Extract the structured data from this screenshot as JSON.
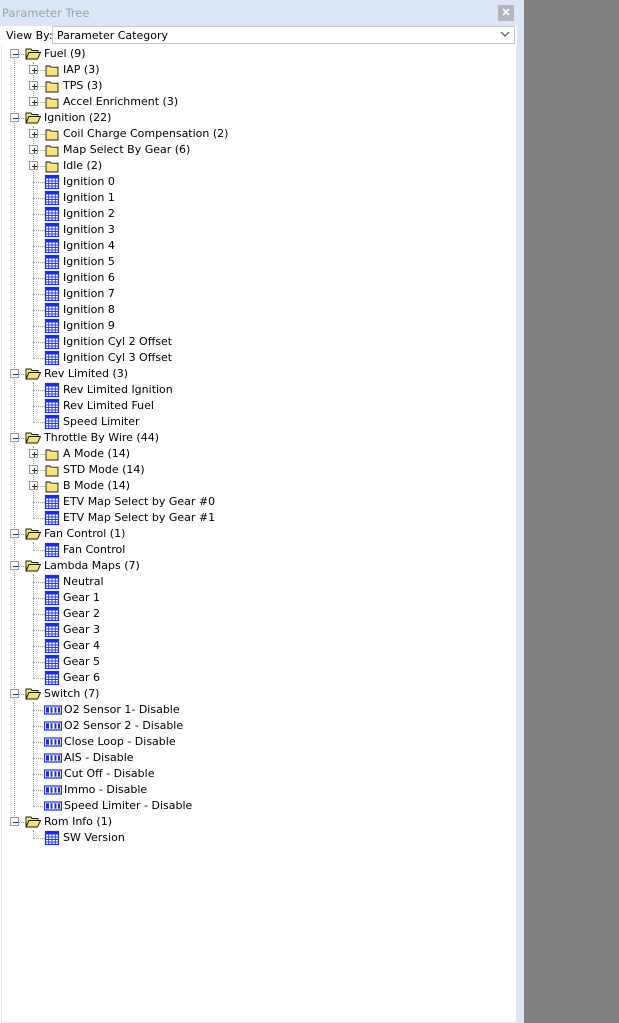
{
  "panel": {
    "title": "Parameter Tree",
    "close_glyph": "×",
    "view_by_label": "View By:",
    "view_by_value": "Parameter Category"
  },
  "colors": {
    "background_gray": "#808080",
    "titlebar": "#dde7f3",
    "folder_fill": "#f9e27e",
    "table_icon": "#1c2dd8",
    "switch_icon": "#1c2dd8"
  },
  "tree": [
    {
      "label": "Fuel (9)",
      "level": 0,
      "type": "folder-open",
      "expander": "minus"
    },
    {
      "label": "IAP (3)",
      "level": 1,
      "type": "folder",
      "expander": "plus"
    },
    {
      "label": "TPS (3)",
      "level": 1,
      "type": "folder",
      "expander": "plus"
    },
    {
      "label": "Accel Enrichment (3)",
      "level": 1,
      "type": "folder",
      "expander": "plus"
    },
    {
      "label": "Ignition (22)",
      "level": 0,
      "type": "folder-open",
      "expander": "minus"
    },
    {
      "label": "Coil Charge Compensation (2)",
      "level": 1,
      "type": "folder",
      "expander": "plus"
    },
    {
      "label": "Map Select By Gear (6)",
      "level": 1,
      "type": "folder",
      "expander": "plus"
    },
    {
      "label": "Idle (2)",
      "level": 1,
      "type": "folder",
      "expander": "plus"
    },
    {
      "label": "Ignition 0",
      "level": 1,
      "type": "table"
    },
    {
      "label": "Ignition 1",
      "level": 1,
      "type": "table"
    },
    {
      "label": "Ignition 2",
      "level": 1,
      "type": "table"
    },
    {
      "label": "Ignition 3",
      "level": 1,
      "type": "table"
    },
    {
      "label": "Ignition 4",
      "level": 1,
      "type": "table"
    },
    {
      "label": "Ignition 5",
      "level": 1,
      "type": "table"
    },
    {
      "label": "Ignition 6",
      "level": 1,
      "type": "table"
    },
    {
      "label": "Ignition 7",
      "level": 1,
      "type": "table"
    },
    {
      "label": "Ignition 8",
      "level": 1,
      "type": "table"
    },
    {
      "label": "Ignition 9",
      "level": 1,
      "type": "table"
    },
    {
      "label": "Ignition Cyl 2 Offset",
      "level": 1,
      "type": "table"
    },
    {
      "label": "Ignition Cyl 3 Offset",
      "level": 1,
      "type": "table"
    },
    {
      "label": "Rev Limited (3)",
      "level": 0,
      "type": "folder-open",
      "expander": "minus"
    },
    {
      "label": "Rev Limited Ignition",
      "level": 1,
      "type": "table"
    },
    {
      "label": "Rev Limited Fuel",
      "level": 1,
      "type": "table"
    },
    {
      "label": "Speed Limiter",
      "level": 1,
      "type": "table"
    },
    {
      "label": "Throttle By Wire (44)",
      "level": 0,
      "type": "folder-open",
      "expander": "minus"
    },
    {
      "label": "A Mode (14)",
      "level": 1,
      "type": "folder",
      "expander": "plus"
    },
    {
      "label": "STD Mode (14)",
      "level": 1,
      "type": "folder",
      "expander": "plus"
    },
    {
      "label": "B Mode (14)",
      "level": 1,
      "type": "folder",
      "expander": "plus"
    },
    {
      "label": "ETV Map Select by Gear #0",
      "level": 1,
      "type": "table"
    },
    {
      "label": "ETV Map Select by Gear #1",
      "level": 1,
      "type": "table"
    },
    {
      "label": "Fan Control (1)",
      "level": 0,
      "type": "folder-open",
      "expander": "minus"
    },
    {
      "label": "Fan Control",
      "level": 1,
      "type": "table"
    },
    {
      "label": "Lambda Maps (7)",
      "level": 0,
      "type": "folder-open",
      "expander": "minus"
    },
    {
      "label": "Neutral",
      "level": 1,
      "type": "table"
    },
    {
      "label": "Gear 1",
      "level": 1,
      "type": "table"
    },
    {
      "label": "Gear 2",
      "level": 1,
      "type": "table"
    },
    {
      "label": "Gear 3",
      "level": 1,
      "type": "table"
    },
    {
      "label": "Gear 4",
      "level": 1,
      "type": "table"
    },
    {
      "label": "Gear 5",
      "level": 1,
      "type": "table"
    },
    {
      "label": "Gear 6",
      "level": 1,
      "type": "table"
    },
    {
      "label": "Switch (7)",
      "level": 0,
      "type": "folder-open",
      "expander": "minus"
    },
    {
      "label": "O2 Sensor 1- Disable",
      "level": 1,
      "type": "switch"
    },
    {
      "label": "O2 Sensor 2 - Disable",
      "level": 1,
      "type": "switch"
    },
    {
      "label": "Close Loop - Disable",
      "level": 1,
      "type": "switch"
    },
    {
      "label": "AIS - Disable",
      "level": 1,
      "type": "switch"
    },
    {
      "label": "Cut Off - Disable",
      "level": 1,
      "type": "switch"
    },
    {
      "label": "Immo - Disable",
      "level": 1,
      "type": "switch"
    },
    {
      "label": "Speed Limiter - Disable",
      "level": 1,
      "type": "switch"
    },
    {
      "label": "Rom Info (1)",
      "level": 0,
      "type": "folder-open",
      "expander": "minus"
    },
    {
      "label": "SW Version",
      "level": 1,
      "type": "table"
    }
  ]
}
